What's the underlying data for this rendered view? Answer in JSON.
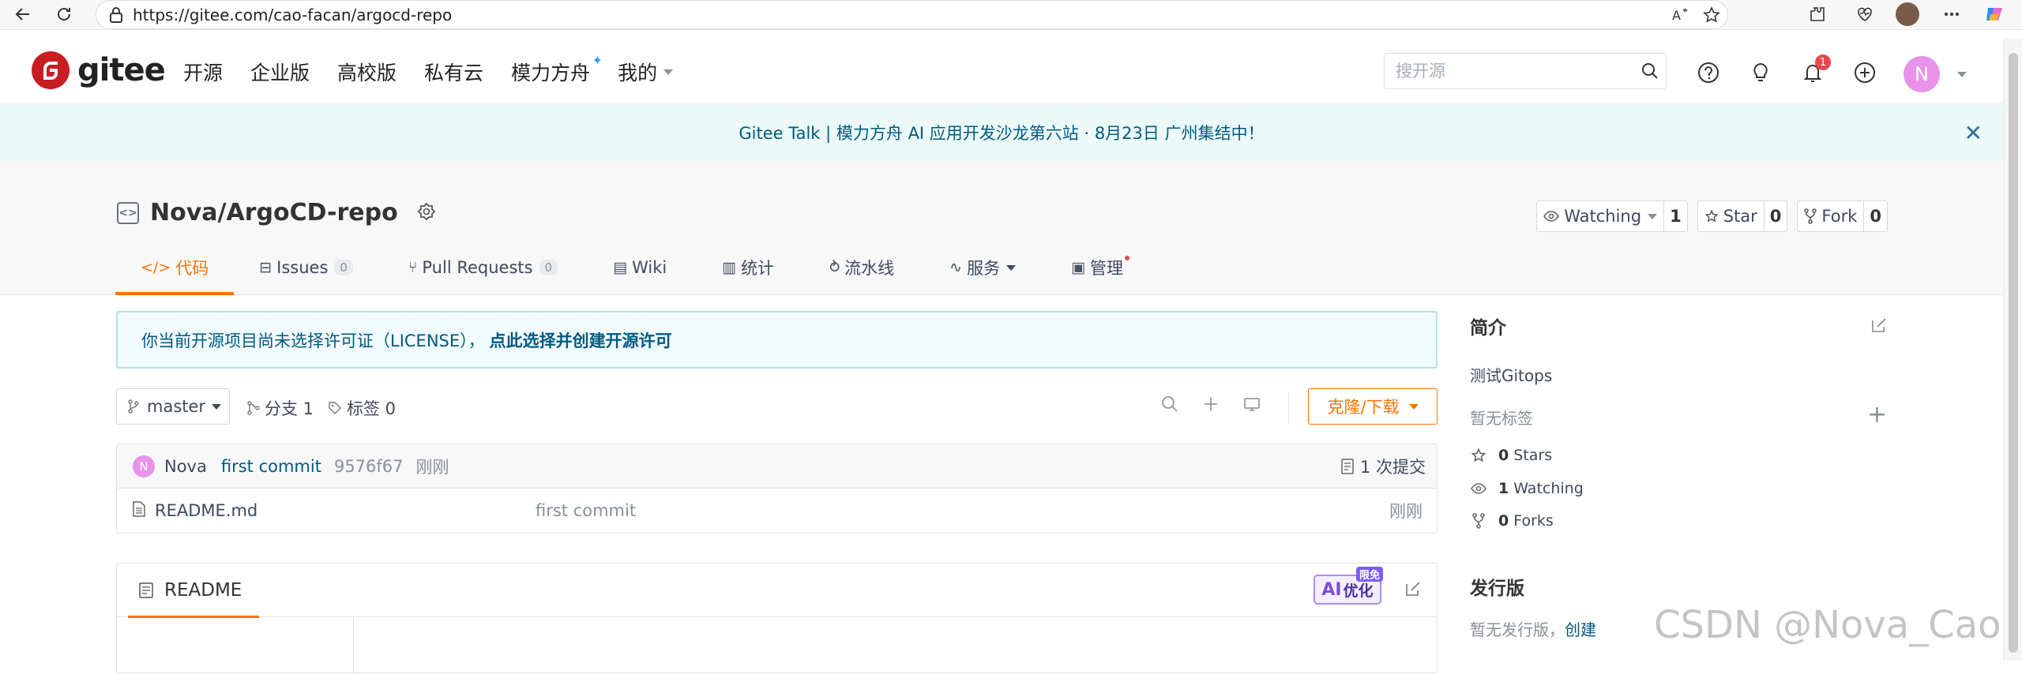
{
  "browser": {
    "url": "https://gitee.com/cao-facan/argocd-repo"
  },
  "header": {
    "logo_text": "gitee",
    "nav": [
      "开源",
      "企业版",
      "高校版",
      "私有云",
      "模力方舟",
      "我的"
    ],
    "search_placeholder": "搜开源",
    "notification_count": "1",
    "avatar_letter": "N"
  },
  "announcement": {
    "text": "Gitee Talk | 模力方舟 AI 应用开发沙龙第六站 · 8月23日 广州集结中！"
  },
  "repo": {
    "full_name": "Nova/ArgoCD-repo",
    "watching_label": "Watching",
    "watching_count": "1",
    "star_label": "Star",
    "star_count": "0",
    "fork_label": "Fork",
    "fork_count": "0",
    "tabs": [
      {
        "label": "代码"
      },
      {
        "label": "Issues",
        "count": "0"
      },
      {
        "label": "Pull Requests",
        "count": "0"
      },
      {
        "label": "Wiki"
      },
      {
        "label": "统计"
      },
      {
        "label": "流水线"
      },
      {
        "label": "服务"
      },
      {
        "label": "管理"
      }
    ]
  },
  "license_notice": {
    "text": "你当前开源项目尚未选择许可证（LICENSE），",
    "link": "点此选择并创建开源许可"
  },
  "branch_bar": {
    "branch": "master",
    "branches": "分支 1",
    "tags": "标签 0",
    "clone_label": "克隆/下载"
  },
  "commit": {
    "author_initial": "N",
    "author": "Nova",
    "message": "first commit",
    "sha": "9576f67",
    "time": "刚刚",
    "count": "1 次提交"
  },
  "files": [
    {
      "name": "README.md",
      "message": "first commit",
      "time": "刚刚"
    }
  ],
  "readme": {
    "title": "README",
    "ai_label_1": "AI",
    "ai_label_2": "优化",
    "ai_badge": "限免"
  },
  "sidebar": {
    "intro_title": "简介",
    "description": "测试Gitops",
    "no_tags": "暂无标签",
    "stars_count": "0",
    "stars_label": "Stars",
    "watching_count": "1",
    "watching_label": "Watching",
    "forks_count": "0",
    "forks_label": "Forks",
    "release_title": "发行版",
    "no_release": "暂无发行版，",
    "create_link": "创建"
  },
  "watermark": "CSDN @Nova_CaoFc",
  "colors": {
    "brand": "#c71d23",
    "accent": "#fe7300",
    "link": "#005980"
  }
}
